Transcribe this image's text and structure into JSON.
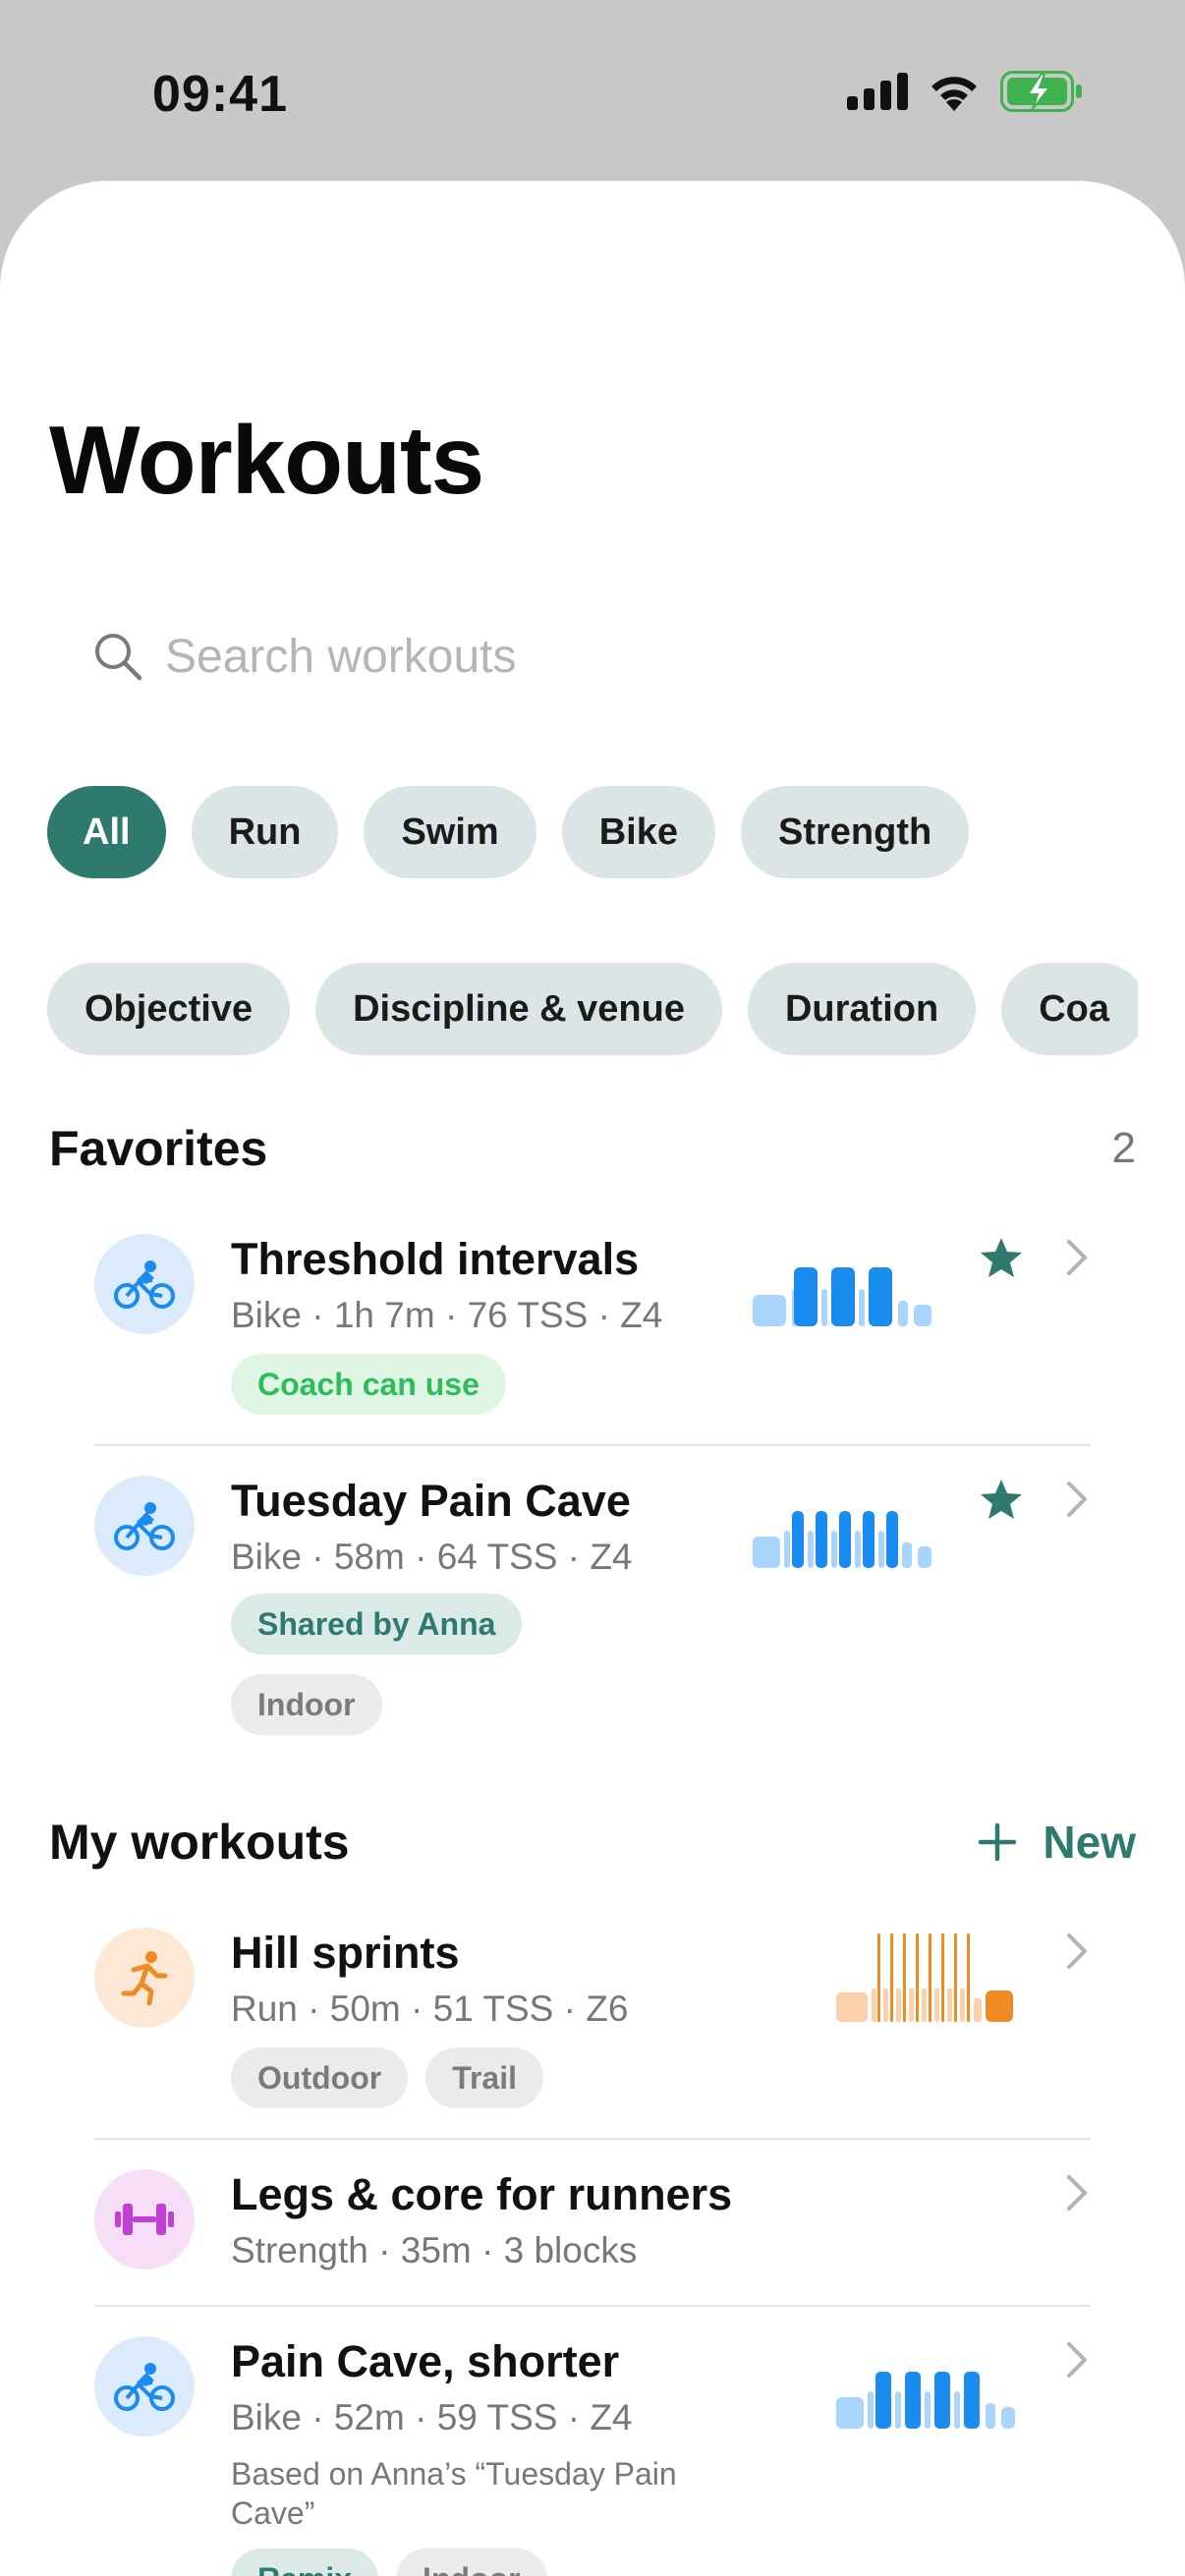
{
  "status": {
    "time": "09:41"
  },
  "page": {
    "title": "Workouts"
  },
  "search": {
    "placeholder": "Search workouts"
  },
  "type_chips": [
    "All",
    "Run",
    "Swim",
    "Bike",
    "Strength"
  ],
  "active_type": "All",
  "filter_chips": [
    "Objective",
    "Discipline & venue",
    "Duration",
    "Coa"
  ],
  "favorites": {
    "title": "Favorites",
    "count": "2",
    "items": [
      {
        "title": "Threshold intervals",
        "meta": "Bike · 1h 7m · 76 TSS · Z4",
        "tags": [
          "Coach can use"
        ],
        "icon": "bike-icon",
        "starred": true
      },
      {
        "title": "Tuesday Pain Cave",
        "meta": "Bike · 58m · 64 TSS · Z4",
        "tags": [
          "Shared by Anna",
          "Indoor"
        ],
        "icon": "bike-icon",
        "starred": true
      }
    ]
  },
  "my_workouts": {
    "title": "My workouts",
    "new_label": "New",
    "items": [
      {
        "title": "Hill sprints",
        "meta": "Run · 50m · 51 TSS · Z6",
        "tags": [
          "Outdoor",
          "Trail"
        ],
        "icon": "run-icon"
      },
      {
        "title": "Legs & core for runners",
        "meta": "Strength · 35m · 3 blocks",
        "tags": [],
        "icon": "dumbbell-icon"
      },
      {
        "title": "Pain Cave, shorter",
        "meta": "Bike · 52m · 59 TSS · Z4",
        "note": "Based on Anna’s “Tuesday Pain Cave”",
        "tags": [
          "Remix",
          "Indoor"
        ],
        "icon": "bike-icon"
      }
    ]
  },
  "colors": {
    "accent": "#2f7a6f",
    "bike": "#1a8cf0",
    "run": "#f08a24",
    "strength": "#c23fd6",
    "star": "#2f7a6f"
  }
}
